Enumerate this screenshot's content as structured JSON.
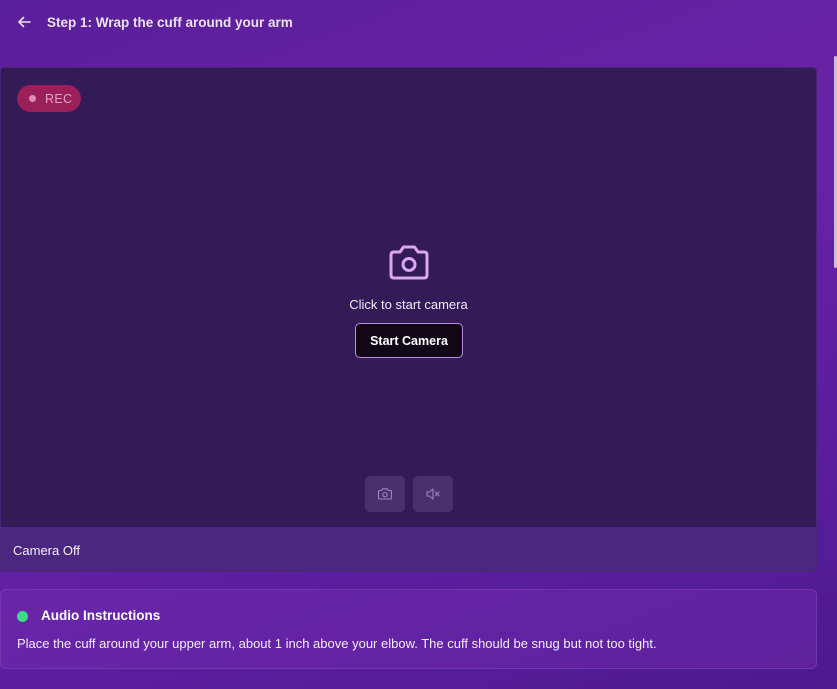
{
  "header": {
    "title": "Step 1: Wrap the cuff around your arm",
    "back_icon": "arrow-left-icon"
  },
  "camera": {
    "rec_label": "REC",
    "prompt": "Click to start camera",
    "start_button_label": "Start Camera",
    "status": "Camera Off",
    "center_icon": "camera-icon",
    "controls": [
      {
        "icon": "camera-icon",
        "action": "snapshot"
      },
      {
        "icon": "speaker-muted-icon",
        "action": "mute"
      }
    ]
  },
  "audio": {
    "title": "Audio Instructions",
    "status_color": "#3ddc84",
    "body": "Place the cuff around your upper arm, about 1 inch above your elbow. The cuff should be snug but not too tight."
  },
  "colors": {
    "accent": "#b98ce4",
    "rec": "#9b1f58",
    "background": "#6a22a8"
  }
}
